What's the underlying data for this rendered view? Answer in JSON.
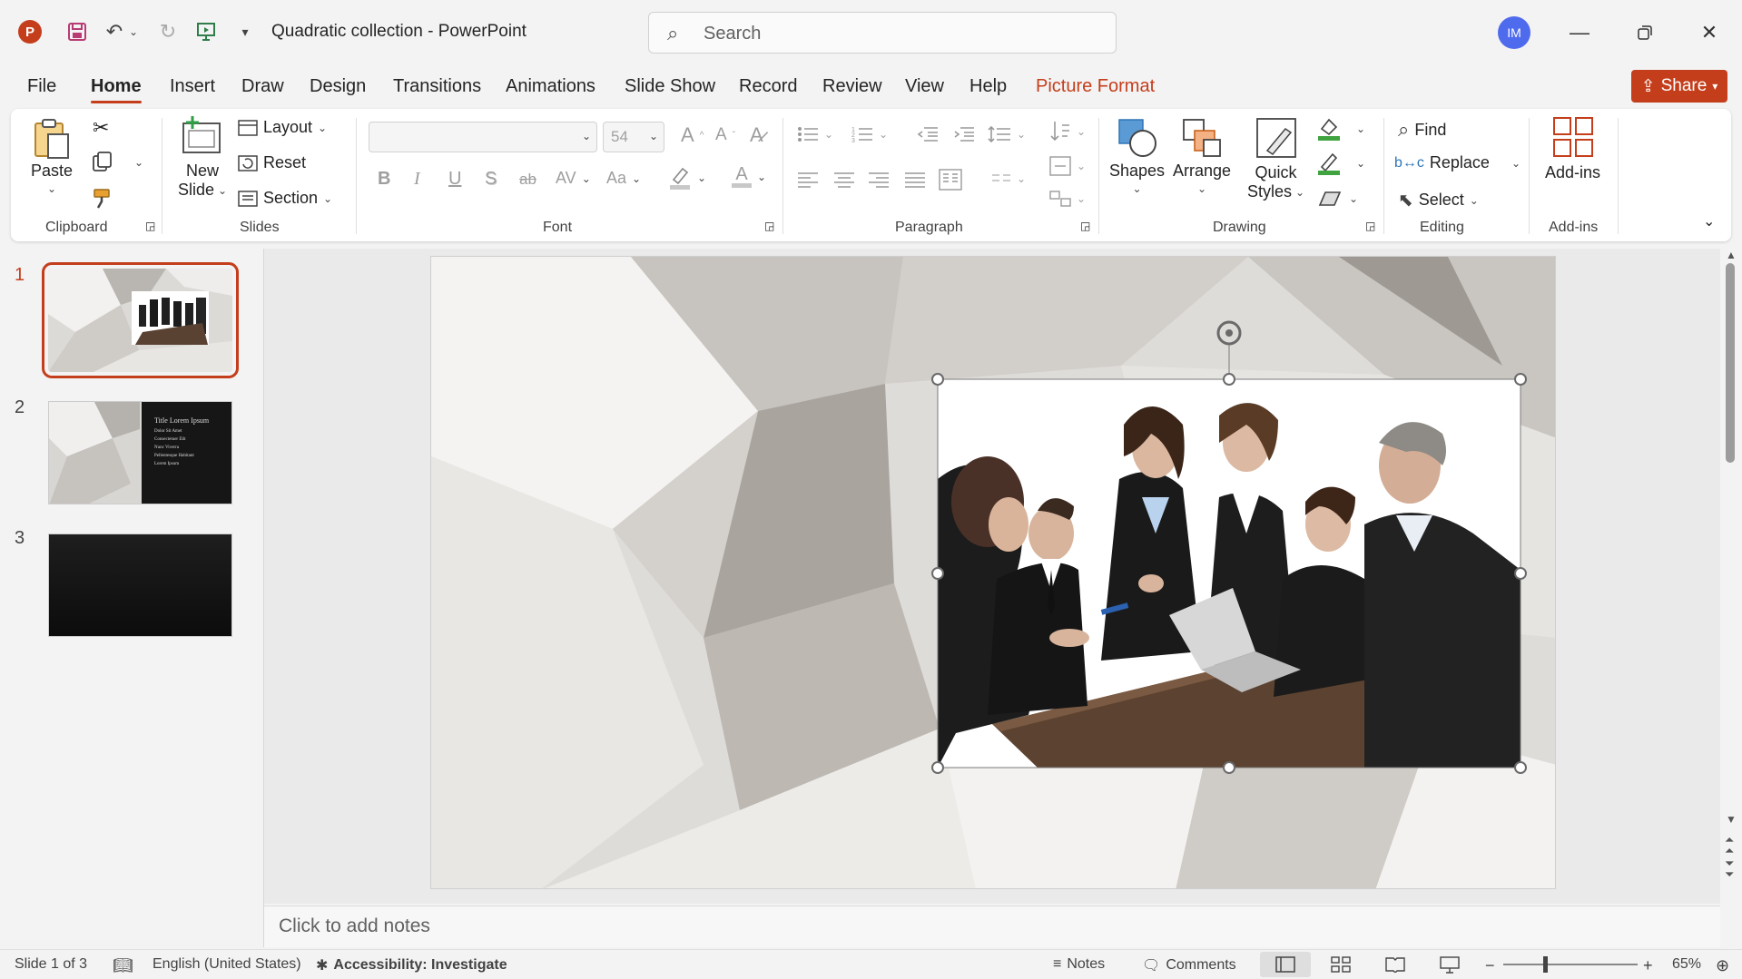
{
  "titlebar": {
    "doc_title": "Quadratic collection  -  PowerPoint",
    "search_placeholder": "Search",
    "avatar_initials": "IM"
  },
  "tabs": [
    "File",
    "Home",
    "Insert",
    "Draw",
    "Design",
    "Transitions",
    "Animations",
    "Slide Show",
    "Record",
    "Review",
    "View",
    "Help",
    "Picture Format"
  ],
  "share_label": "Share",
  "ribbon": {
    "clipboard": {
      "label": "Clipboard",
      "paste": "Paste"
    },
    "slides": {
      "label": "Slides",
      "new_slide_1": "New",
      "new_slide_2": "Slide",
      "layout": "Layout",
      "reset": "Reset",
      "section": "Section"
    },
    "font": {
      "label": "Font",
      "size": "54",
      "bold": "B",
      "italic": "I",
      "underline": "U",
      "shadow": "S",
      "strike": "ab",
      "spacing": "AV",
      "case": "Aa",
      "grow": "A",
      "shrink": "A",
      "color": "A"
    },
    "paragraph": {
      "label": "Paragraph"
    },
    "drawing": {
      "label": "Drawing",
      "shapes": "Shapes",
      "arrange": "Arrange",
      "quick_styles_1": "Quick",
      "quick_styles_2": "Styles"
    },
    "editing": {
      "label": "Editing",
      "find": "Find",
      "replace": "Replace",
      "select": "Select"
    },
    "addins": {
      "label": "Add-ins",
      "addins": "Add-ins"
    }
  },
  "slides": [
    {
      "number": "1"
    },
    {
      "number": "2",
      "title": "Title Lorem Ipsum",
      "lines": [
        "Dolor Sit Amet",
        "Consectetuer Elit",
        "Nunc Viverra",
        "Pellentesque Habitant",
        "Lorem Ipsum"
      ]
    },
    {
      "number": "3"
    }
  ],
  "notes_placeholder": "Click to add notes",
  "status": {
    "slide_info": "Slide 1 of 3",
    "language": "English (United States)",
    "accessibility": "Accessibility: Investigate",
    "notes": "Notes",
    "comments": "Comments",
    "zoom": "65%"
  },
  "colors": {
    "accent": "#c43e1c",
    "avatar": "#4f6bed",
    "selection_border": "#c43e1c"
  },
  "icons": [
    "powerpoint-logo",
    "save-icon",
    "undo-icon",
    "redo-icon",
    "present-icon",
    "customize-icon",
    "search-icon",
    "minimize-icon",
    "restore-icon",
    "close-icon"
  ]
}
